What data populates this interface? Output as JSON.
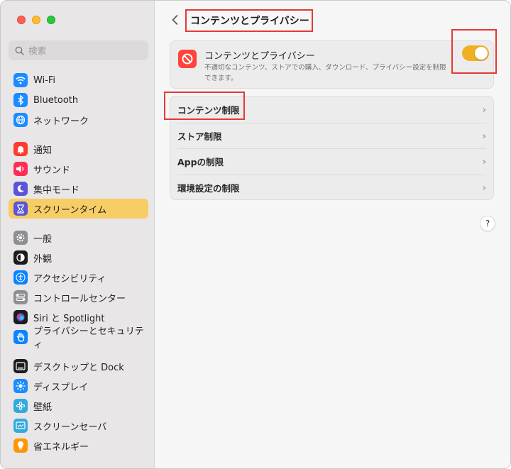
{
  "sidebar": {
    "search_placeholder": "検索",
    "items": [
      {
        "label": "Wi-Fi",
        "icon": "wifi-icon",
        "color": "#1a8cff"
      },
      {
        "label": "Bluetooth",
        "icon": "bluetooth-icon",
        "color": "#1a8cff"
      },
      {
        "label": "ネットワーク",
        "icon": "globe-icon",
        "color": "#1a8cff"
      },
      {
        "label": "通知",
        "icon": "bell-icon",
        "color": "#ff3b30"
      },
      {
        "label": "サウンド",
        "icon": "speaker-icon",
        "color": "#ff2d55"
      },
      {
        "label": "集中モード",
        "icon": "moon-icon",
        "color": "#5856d6"
      },
      {
        "label": "スクリーンタイム",
        "icon": "hourglass-icon",
        "color": "#5856d6"
      },
      {
        "label": "一般",
        "icon": "gear-icon",
        "color": "#8e8e93"
      },
      {
        "label": "外観",
        "icon": "appearance-icon",
        "color": "#1c1c1e"
      },
      {
        "label": "アクセシビリティ",
        "icon": "accessibility-icon",
        "color": "#0a84ff"
      },
      {
        "label": "コントロールセンター",
        "icon": "control-center-icon",
        "color": "#8e8e93"
      },
      {
        "label": "Siri と Spotlight",
        "icon": "siri-icon",
        "color": "#1c1c1e"
      },
      {
        "label": "プライバシーとセキュリティ",
        "icon": "hand-icon",
        "color": "#0a84ff"
      },
      {
        "label": "デスクトップと Dock",
        "icon": "dock-icon",
        "color": "#1c1c1e"
      },
      {
        "label": "ディスプレイ",
        "icon": "sun-icon",
        "color": "#1a8cff"
      },
      {
        "label": "壁紙",
        "icon": "wallpaper-icon",
        "color": "#34aadc"
      },
      {
        "label": "スクリーンセーバ",
        "icon": "screensaver-icon",
        "color": "#34aadc"
      },
      {
        "label": "省エネルギー",
        "icon": "bulb-icon",
        "color": "#ff9500"
      }
    ],
    "selected": "スクリーンタイム",
    "selected_color": "#f7cd66"
  },
  "main": {
    "title": "コンテンツとプライバシー",
    "setting": {
      "title": "コンテンツとプライバシー",
      "description": "不適切なコンテンツ、ストアでの購入、ダウンロード、プライバシー設定を制限できます。",
      "toggle_on": true,
      "toggle_color": "#f0b020"
    },
    "rows": [
      {
        "label": "コンテンツ制限"
      },
      {
        "label": "ストア制限"
      },
      {
        "label": "Appの制限"
      },
      {
        "label": "環境設定の制限"
      }
    ],
    "help_label": "?"
  },
  "highlight_color": "#e53935"
}
